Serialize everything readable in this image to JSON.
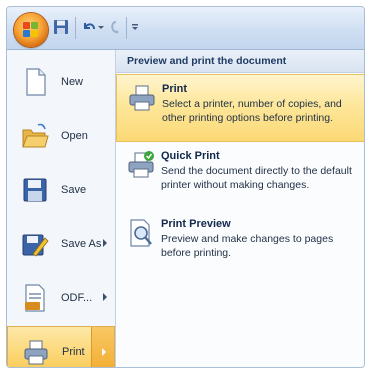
{
  "menu": {
    "items": [
      {
        "label": "New",
        "underline": "N",
        "icon": "new-document-icon",
        "arrow": false
      },
      {
        "label": "Open",
        "underline": "O",
        "icon": "open-folder-icon",
        "arrow": false
      },
      {
        "label": "Save",
        "underline": "S",
        "icon": "floppy-disk-icon",
        "arrow": false
      },
      {
        "label": "Save As",
        "underline": "A",
        "icon": "save-as-icon",
        "arrow": true
      },
      {
        "label": "ODF...",
        "underline": "",
        "icon": "odf-document-icon",
        "arrow": true
      },
      {
        "label": "Print",
        "underline": "P",
        "icon": "printer-icon",
        "arrow": true,
        "active": true
      }
    ]
  },
  "submenu": {
    "header": "Preview and print the document",
    "items": [
      {
        "title": "Print",
        "underline": "P",
        "description": "Select a printer, number of copies, and other printing options before printing.",
        "icon": "printer-icon",
        "highlighted": true
      },
      {
        "title": "Quick Print",
        "underline": "Q",
        "description": "Send the document directly to the default printer without making changes.",
        "icon": "quick-print-icon"
      },
      {
        "title": "Print Preview",
        "underline": "v",
        "description": "Preview and make changes to pages before printing.",
        "icon": "print-preview-icon"
      }
    ]
  },
  "colors": {
    "highlight": "#fcd87a",
    "frame": "#dfe8f5",
    "header_text": "#1f3a63"
  }
}
